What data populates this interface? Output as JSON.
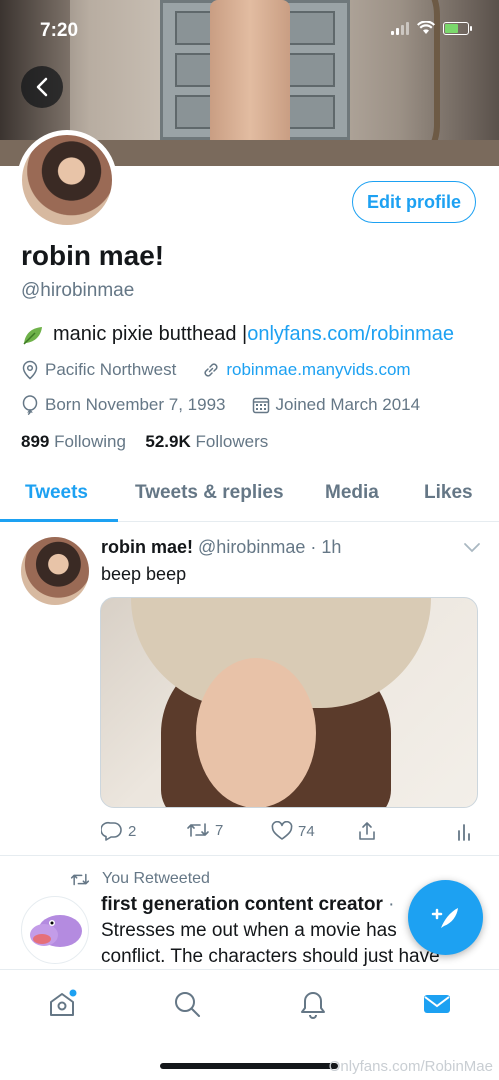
{
  "status_bar": {
    "time": "7:20"
  },
  "profile": {
    "edit_button": "Edit profile",
    "name": "robin mae!",
    "handle": "@hirobinmae",
    "bio_text": "manic pixie butthead |",
    "bio_link": "onlyfans.com/robinmae",
    "location": "Pacific Northwest",
    "website": "robinmae.manyvids.com",
    "birthday": "Born November 7, 1993",
    "joined": "Joined March 2014",
    "following_count": "899",
    "following_label": "Following",
    "followers_count": "52.9K",
    "followers_label": "Followers"
  },
  "tabs": [
    {
      "label": "Tweets",
      "active": true
    },
    {
      "label": "Tweets & replies",
      "active": false
    },
    {
      "label": "Media",
      "active": false
    },
    {
      "label": "Likes",
      "active": false
    }
  ],
  "tweets": [
    {
      "name": "robin mae!",
      "handle_time": "@hirobinmae · 1h",
      "text": "beep beep",
      "replies": "2",
      "retweets": "7",
      "likes": "74"
    },
    {
      "retweeted_label": "You Retweeted",
      "name": "first generation content creator",
      "separator": "·",
      "text_line1": "Stresses me out when a movie has",
      "text_line2": "conflict. The characters should just have"
    }
  ],
  "colors": {
    "accent": "#1da1f2",
    "secondary_text": "#657786",
    "primary_text": "#14171a"
  },
  "watermark": "Onlyfans.com/RobinMae"
}
